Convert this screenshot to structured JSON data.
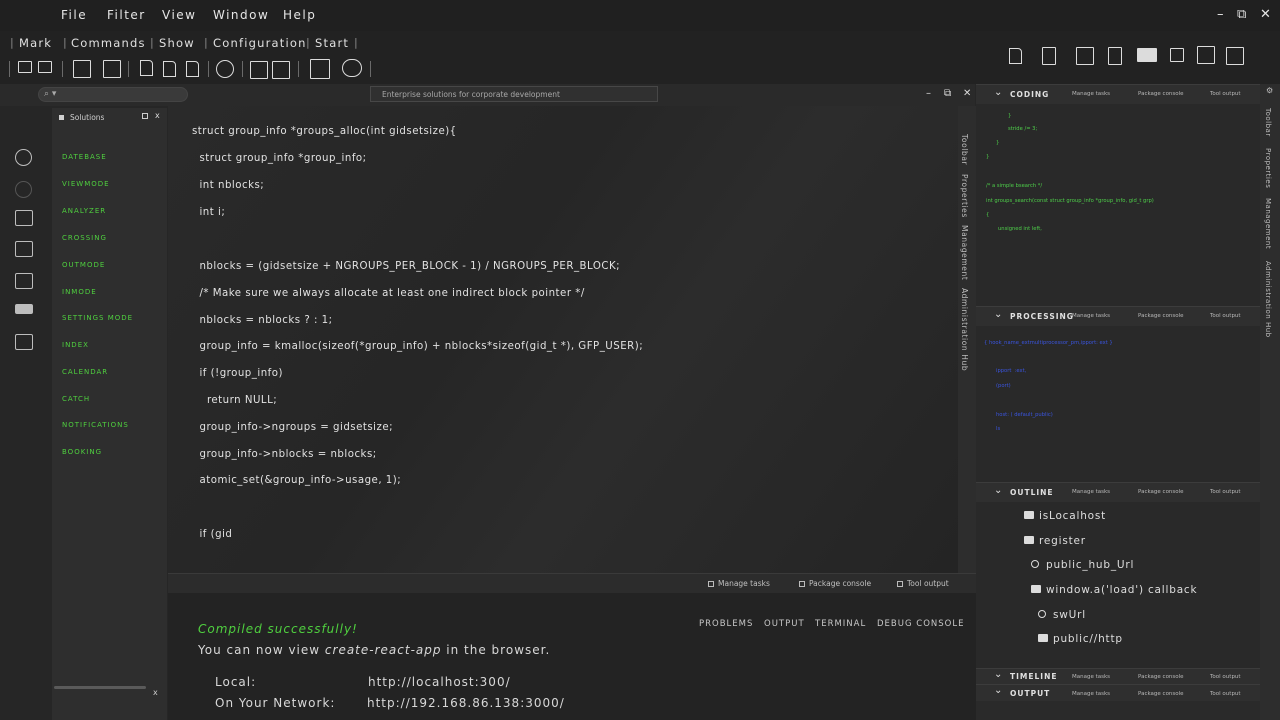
{
  "menubar": {
    "items": [
      "File",
      "Filter",
      "View",
      "Window",
      "Help"
    ],
    "controls": {
      "minimize": "–",
      "restore": "⧉",
      "close": "✕"
    }
  },
  "submenu": {
    "items": [
      "Mark",
      "Commands",
      "Show",
      "Configuration",
      "Start"
    ],
    "separator": "|"
  },
  "search": {
    "placeholder": "",
    "icon": "search-icon"
  },
  "document_title": "Enterprise solutions for corporate development",
  "panel_controls": {
    "minimize": "–",
    "restore": "⧉",
    "close": "✕"
  },
  "solutions": {
    "title": "Solutions",
    "close": "x",
    "items": [
      "DATEBASE",
      "VIEWMODE",
      "ANALYZER",
      "CROSSING",
      "OUTMODE",
      "INMODE",
      "SETTINGS MODE",
      "INDEX",
      "CALENDAR",
      "CATCH",
      "NOTIFICATIONS",
      "BOOKING"
    ],
    "footer_close": "x"
  },
  "editor": {
    "lines": [
      "struct group_info *groups_alloc(int gidsetsize){",
      "  struct group_info *group_info;",
      "  int nblocks;",
      "  int i;",
      "",
      "  nblocks = (gidsetsize + NGROUPS_PER_BLOCK - 1) / NGROUPS_PER_BLOCK;",
      "  /* Make sure we always allocate at least one indirect block pointer */",
      "  nblocks = nblocks ? : 1;",
      "  group_info = kmalloc(sizeof(*group_info) + nblocks*sizeof(gid_t *), GFP_USER);",
      "  if (!group_info)",
      "    return NULL;",
      "  group_info->ngroups = gidsetsize;",
      "  group_info->nblocks = nblocks;",
      "  atomic_set(&group_info->usage, 1);",
      "",
      "  if (gid"
    ]
  },
  "vertical_tabs": [
    "Toolbar",
    "Properties",
    "Management",
    "Administration Hub"
  ],
  "bottom_panel": {
    "header_tools": [
      "Manage tasks",
      "Package console",
      "Tool output"
    ],
    "tabs": [
      "PROBLEMS",
      "OUTPUT",
      "TERMINAL",
      "DEBUG CONSOLE"
    ],
    "compiled": "Compiled successfully!",
    "view_prefix": "You can now view ",
    "view_app": "create-react-app",
    "view_suffix": " in the browser.",
    "local_label": "Local:",
    "local_url": "http://localhost:300/",
    "network_label": "On Your Network:",
    "network_url": "http://192.168.86.138:3000/"
  },
  "right_panes": {
    "tools": [
      "Manage tasks",
      "Package console",
      "Tool output"
    ],
    "coding": {
      "title": "CODING",
      "lines": [
        "}",
        "stride /= 3;",
        "}",
        "}",
        "/* a simple bsearch */",
        "int groups_search(const struct group_info *group_info, gid_t grp)",
        "{",
        "unsigned int left,"
      ]
    },
    "processing": {
      "title": "PROCESSING",
      "lines": [
        "{ hook_name_extmultiprocessor_pm,ipport: ext }",
        "ipport  :ext,",
        "(port)",
        "host: ( default_public)",
        "ls"
      ]
    },
    "outline": {
      "title": "OUTLINE",
      "items": [
        {
          "label": "isLocalhost",
          "icon": "folder-icon"
        },
        {
          "label": "register",
          "icon": "folder-icon"
        },
        {
          "label": "public_hub_Url",
          "icon": "gear-icon"
        },
        {
          "label": "window.a('load') callback",
          "icon": "folder-icon"
        },
        {
          "label": "swUrl",
          "icon": "gear-icon"
        },
        {
          "label": "public//http",
          "icon": "folder-icon"
        }
      ]
    },
    "timeline": {
      "title": "TIMELINE"
    },
    "output": {
      "title": "OUTPUT"
    }
  },
  "far_rail_tabs": [
    "Toolbar",
    "Properties",
    "Management",
    "Administration Hub"
  ],
  "colors": {
    "accent_green": "#4fcf3f",
    "blue_code": "#3a55e0"
  }
}
